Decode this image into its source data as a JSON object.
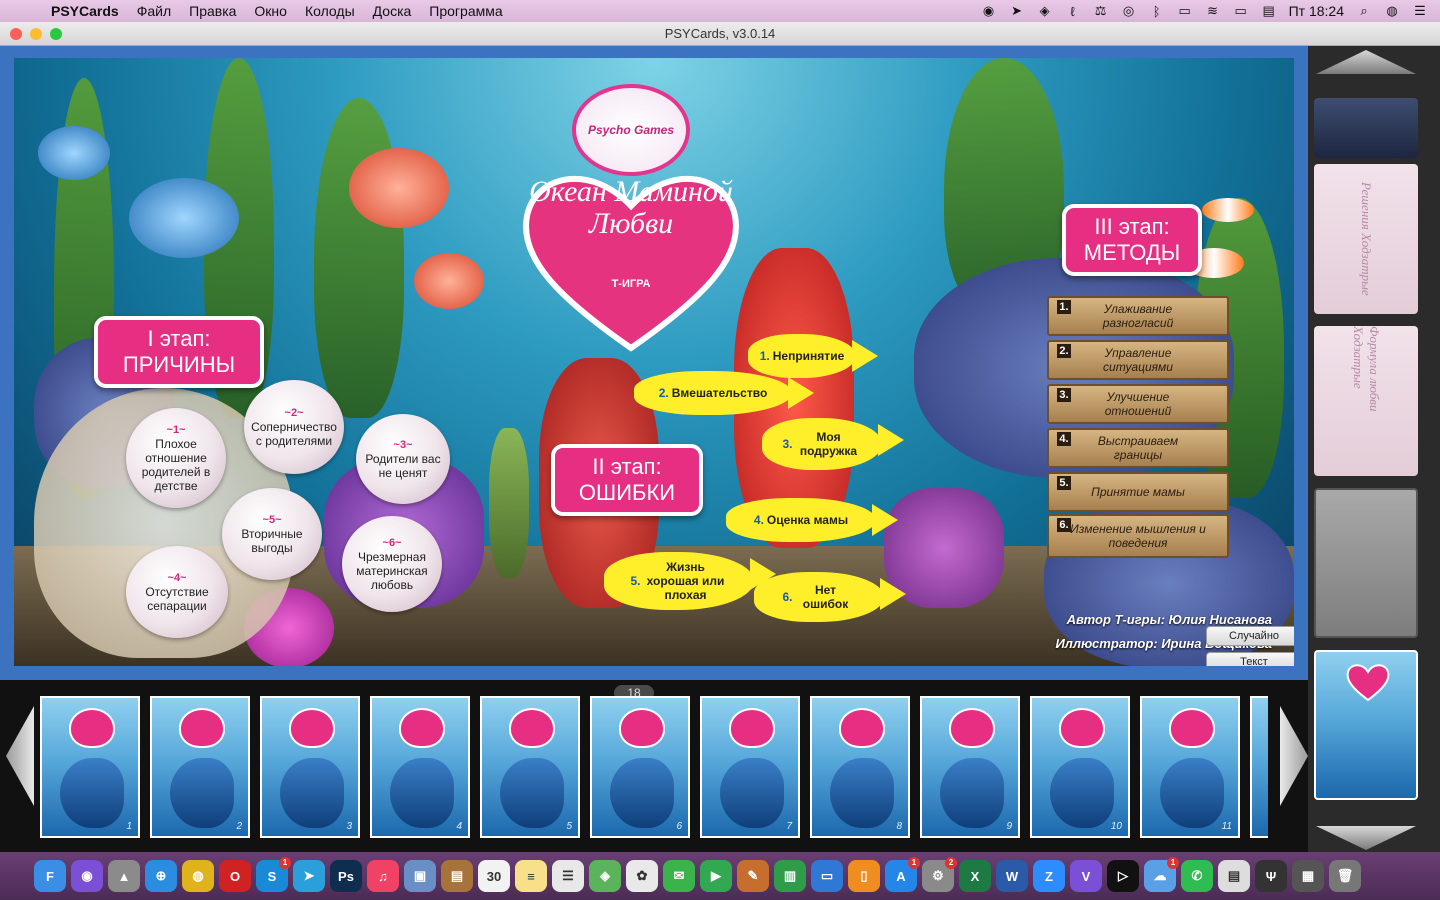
{
  "menubar": {
    "apple": "",
    "items": [
      "PSYCards",
      "Файл",
      "Правка",
      "Окно",
      "Колоды",
      "Доска",
      "Программа"
    ],
    "lang": "",
    "clock": "Пт 18:24",
    "tray_icons": [
      "viber-icon",
      "telegram-icon",
      "shield-icon",
      "script-icon",
      "scale-icon",
      "eye-icon",
      "bluetooth-icon",
      "airplay-icon",
      "wifi-icon",
      "battery-icon",
      "flag-icon"
    ]
  },
  "window": {
    "title": "PSYCards, v3.0.14"
  },
  "board": {
    "logo_text": "Psycho Games",
    "title": "Океан Маминой Любви",
    "subtitle": "Т-ИГРА",
    "stage1": {
      "line1": "I этап:",
      "line2": "ПРИЧИНЫ"
    },
    "stage2": {
      "line1": "II этап:",
      "line2": "ОШИБКИ"
    },
    "stage3": {
      "line1": "III этап:",
      "line2": "МЕТОДЫ"
    },
    "pearls": [
      {
        "num": "~1~",
        "text": "Плохое отношение родителей в детстве"
      },
      {
        "num": "~2~",
        "text": "Соперничество с родителями"
      },
      {
        "num": "~3~",
        "text": "Родители вас не ценят"
      },
      {
        "num": "~4~",
        "text": "Отсутствие сепарации"
      },
      {
        "num": "~5~",
        "text": "Вторичные выгоды"
      },
      {
        "num": "~6~",
        "text": "Чрезмерная материнская любовь"
      }
    ],
    "fish": [
      {
        "n": "1.",
        "text": "Непринятие"
      },
      {
        "n": "2.",
        "text": "Вмешательство"
      },
      {
        "n": "3.",
        "text": "Моя подружка"
      },
      {
        "n": "4.",
        "text": "Оценка мамы"
      },
      {
        "n": "5.",
        "text": "Жизнь хорошая или плохая"
      },
      {
        "n": "6.",
        "text": "Нет ошибок"
      }
    ],
    "planks": [
      {
        "n": "1.",
        "text": "Улаживание разногласий"
      },
      {
        "n": "2.",
        "text": "Управление ситуациями"
      },
      {
        "n": "3.",
        "text": "Улучшение отношений"
      },
      {
        "n": "4.",
        "text": "Выстраиваем границы"
      },
      {
        "n": "5.",
        "text": "Принятие мамы"
      },
      {
        "n": "6.",
        "text": "Изменение мышления и поведения"
      }
    ],
    "author": "Автор Т-игры: Юлия Нисанова",
    "illustrator": "Иллюстратор: Ирина Вощикова",
    "random_btn": "Случайно",
    "text_btn": "Текст"
  },
  "sidepanel": {
    "cards": [
      "Решения Ходзатрые",
      "Формула любви Ходзатрые"
    ]
  },
  "strip": {
    "counter": "18",
    "cards": [
      "1",
      "2",
      "3",
      "4",
      "5",
      "6",
      "7",
      "8",
      "9",
      "10",
      "11"
    ]
  },
  "dock": {
    "apps": [
      {
        "name": "finder",
        "label": "F",
        "color": "#3a8ee6"
      },
      {
        "name": "siri",
        "label": "◉",
        "color": "#7b4fd6"
      },
      {
        "name": "launchpad",
        "label": "▲",
        "color": "#8b8b8b"
      },
      {
        "name": "safari",
        "label": "⊕",
        "color": "#2c8de0"
      },
      {
        "name": "chrome",
        "label": "◍",
        "color": "#e0b21c"
      },
      {
        "name": "opera",
        "label": "O",
        "color": "#d02222"
      },
      {
        "name": "skype",
        "label": "S",
        "color": "#1a8ad6",
        "badge": "1"
      },
      {
        "name": "telegram",
        "label": "➤",
        "color": "#2b9fd9"
      },
      {
        "name": "photoshop",
        "label": "Ps",
        "color": "#0f2d4f"
      },
      {
        "name": "music",
        "label": "♫",
        "color": "#f04264"
      },
      {
        "name": "preview",
        "label": "▣",
        "color": "#6a8fc7"
      },
      {
        "name": "notes-brown",
        "label": "▤",
        "color": "#a6743b"
      },
      {
        "name": "calendar",
        "label": "30",
        "color": "#f2f2f2"
      },
      {
        "name": "notes",
        "label": "≡",
        "color": "#f7e089"
      },
      {
        "name": "reminders",
        "label": "☰",
        "color": "#e8e8e8"
      },
      {
        "name": "maps",
        "label": "◈",
        "color": "#5bb35b"
      },
      {
        "name": "photos",
        "label": "✿",
        "color": "#e9e9e9"
      },
      {
        "name": "messages",
        "label": "✉",
        "color": "#3ab34a"
      },
      {
        "name": "facetime",
        "label": "▶",
        "color": "#32a852"
      },
      {
        "name": "keynote-edit",
        "label": "✎",
        "color": "#c76d2d"
      },
      {
        "name": "numbers",
        "label": "▥",
        "color": "#2e9c49"
      },
      {
        "name": "keynote",
        "label": "▭",
        "color": "#2f78d6"
      },
      {
        "name": "books",
        "label": "▯",
        "color": "#f08d21"
      },
      {
        "name": "appstore",
        "label": "A",
        "color": "#2486e6",
        "badge": "1"
      },
      {
        "name": "settings",
        "label": "⚙",
        "color": "#8a8a8a",
        "badge": "2"
      },
      {
        "name": "excel",
        "label": "X",
        "color": "#1d7a43"
      },
      {
        "name": "word",
        "label": "W",
        "color": "#2a5aa8"
      },
      {
        "name": "zoom",
        "label": "Z",
        "color": "#2d8cff"
      },
      {
        "name": "viber",
        "label": "V",
        "color": "#7b4fd6"
      },
      {
        "name": "quicktime",
        "label": "▷",
        "color": "#111111"
      },
      {
        "name": "cloud",
        "label": "☁",
        "color": "#5aa0e6",
        "badge": "1"
      },
      {
        "name": "whatsapp",
        "label": "✆",
        "color": "#2fbd51"
      },
      {
        "name": "textedit",
        "label": "▤",
        "color": "#dddddd"
      },
      {
        "name": "psycards",
        "label": "Ψ",
        "color": "#333333"
      },
      {
        "name": "downloads",
        "label": "▦",
        "color": "#555555"
      },
      {
        "name": "trash",
        "label": "🗑",
        "color": "#777777"
      }
    ]
  }
}
